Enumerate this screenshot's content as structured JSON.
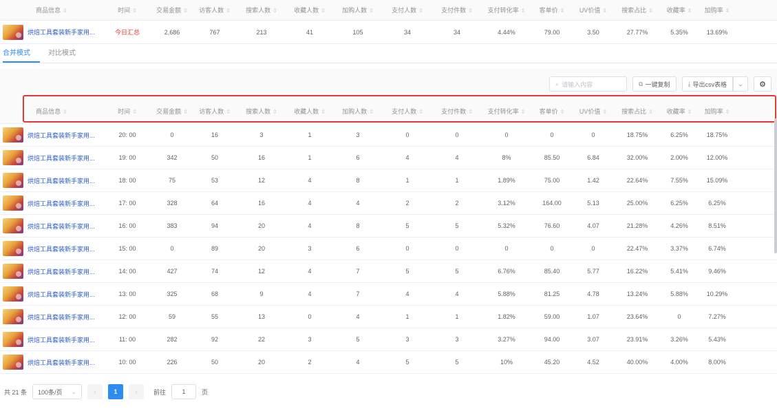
{
  "columns": [
    "商品信息",
    "时间",
    "交易金额",
    "访客人数",
    "搜索人数",
    "收藏人数",
    "加购人数",
    "支付人数",
    "支付件数",
    "支付转化率",
    "客单价",
    "UV价值",
    "搜索占比",
    "收藏率",
    "加购率"
  ],
  "sort_icon": "⇳",
  "summary": {
    "product": "烘焙工具套装新手家用...",
    "time": "今日汇总",
    "values": [
      "2,686",
      "767",
      "213",
      "41",
      "105",
      "34",
      "34",
      "4.44%",
      "79.00",
      "3.50",
      "27.77%",
      "5.35%",
      "13.69%"
    ]
  },
  "tabs": [
    "合并模式",
    "对比模式"
  ],
  "toolbar": {
    "search_placeholder": "请输入内容",
    "copy_label": "一键复制",
    "export_label": "导出csv表格"
  },
  "rows": [
    {
      "product": "烘焙工具套装新手家用...",
      "time": "20: 00",
      "values": [
        "0",
        "16",
        "3",
        "1",
        "3",
        "0",
        "0",
        "0",
        "0",
        "0",
        "18.75%",
        "6.25%",
        "18.75%"
      ]
    },
    {
      "product": "烘焙工具套装新手家用...",
      "time": "19: 00",
      "values": [
        "342",
        "50",
        "16",
        "1",
        "6",
        "4",
        "4",
        "8%",
        "85.50",
        "6.84",
        "32.00%",
        "2.00%",
        "12.00%"
      ]
    },
    {
      "product": "烘焙工具套装新手家用...",
      "time": "18: 00",
      "values": [
        "75",
        "53",
        "12",
        "4",
        "8",
        "1",
        "1",
        "1.89%",
        "75.00",
        "1.42",
        "22.64%",
        "7.55%",
        "15.09%"
      ]
    },
    {
      "product": "烘焙工具套装新手家用...",
      "time": "17: 00",
      "values": [
        "328",
        "64",
        "16",
        "4",
        "4",
        "2",
        "2",
        "3.12%",
        "164.00",
        "5.13",
        "25.00%",
        "6.25%",
        "6.25%"
      ]
    },
    {
      "product": "烘焙工具套装新手家用...",
      "time": "16: 00",
      "values": [
        "383",
        "94",
        "20",
        "4",
        "8",
        "5",
        "5",
        "5.32%",
        "76.60",
        "4.07",
        "21.28%",
        "4.26%",
        "8.51%"
      ]
    },
    {
      "product": "烘焙工具套装新手家用...",
      "time": "15: 00",
      "values": [
        "0",
        "89",
        "20",
        "3",
        "6",
        "0",
        "0",
        "0",
        "0",
        "0",
        "22.47%",
        "3.37%",
        "6.74%"
      ]
    },
    {
      "product": "烘焙工具套装新手家用...",
      "time": "14: 00",
      "values": [
        "427",
        "74",
        "12",
        "4",
        "7",
        "5",
        "5",
        "6.76%",
        "85.40",
        "5.77",
        "16.22%",
        "5.41%",
        "9.46%"
      ]
    },
    {
      "product": "烘焙工具套装新手家用...",
      "time": "13: 00",
      "values": [
        "325",
        "68",
        "9",
        "4",
        "7",
        "4",
        "4",
        "5.88%",
        "81.25",
        "4.78",
        "13.24%",
        "5.88%",
        "10.29%"
      ]
    },
    {
      "product": "烘焙工具套装新手家用...",
      "time": "12: 00",
      "values": [
        "59",
        "55",
        "13",
        "0",
        "4",
        "1",
        "1",
        "1.82%",
        "59.00",
        "1.07",
        "23.64%",
        "0",
        "7.27%"
      ]
    },
    {
      "product": "烘焙工具套装新手家用...",
      "time": "11: 00",
      "values": [
        "282",
        "92",
        "22",
        "3",
        "5",
        "3",
        "3",
        "3.27%",
        "94.00",
        "3.07",
        "23.91%",
        "3.26%",
        "5.43%"
      ]
    },
    {
      "product": "烘焙工具套装新手家用...",
      "time": "10: 00",
      "values": [
        "226",
        "50",
        "20",
        "2",
        "4",
        "5",
        "5",
        "10%",
        "45.20",
        "4.52",
        "40.00%",
        "4.00%",
        "8.00%"
      ]
    }
  ],
  "pagination": {
    "total": "共 21 条",
    "page_size": "100条/页",
    "current_page": "1",
    "goto_label": "前往",
    "goto_value": "1",
    "page_suffix": "页"
  }
}
